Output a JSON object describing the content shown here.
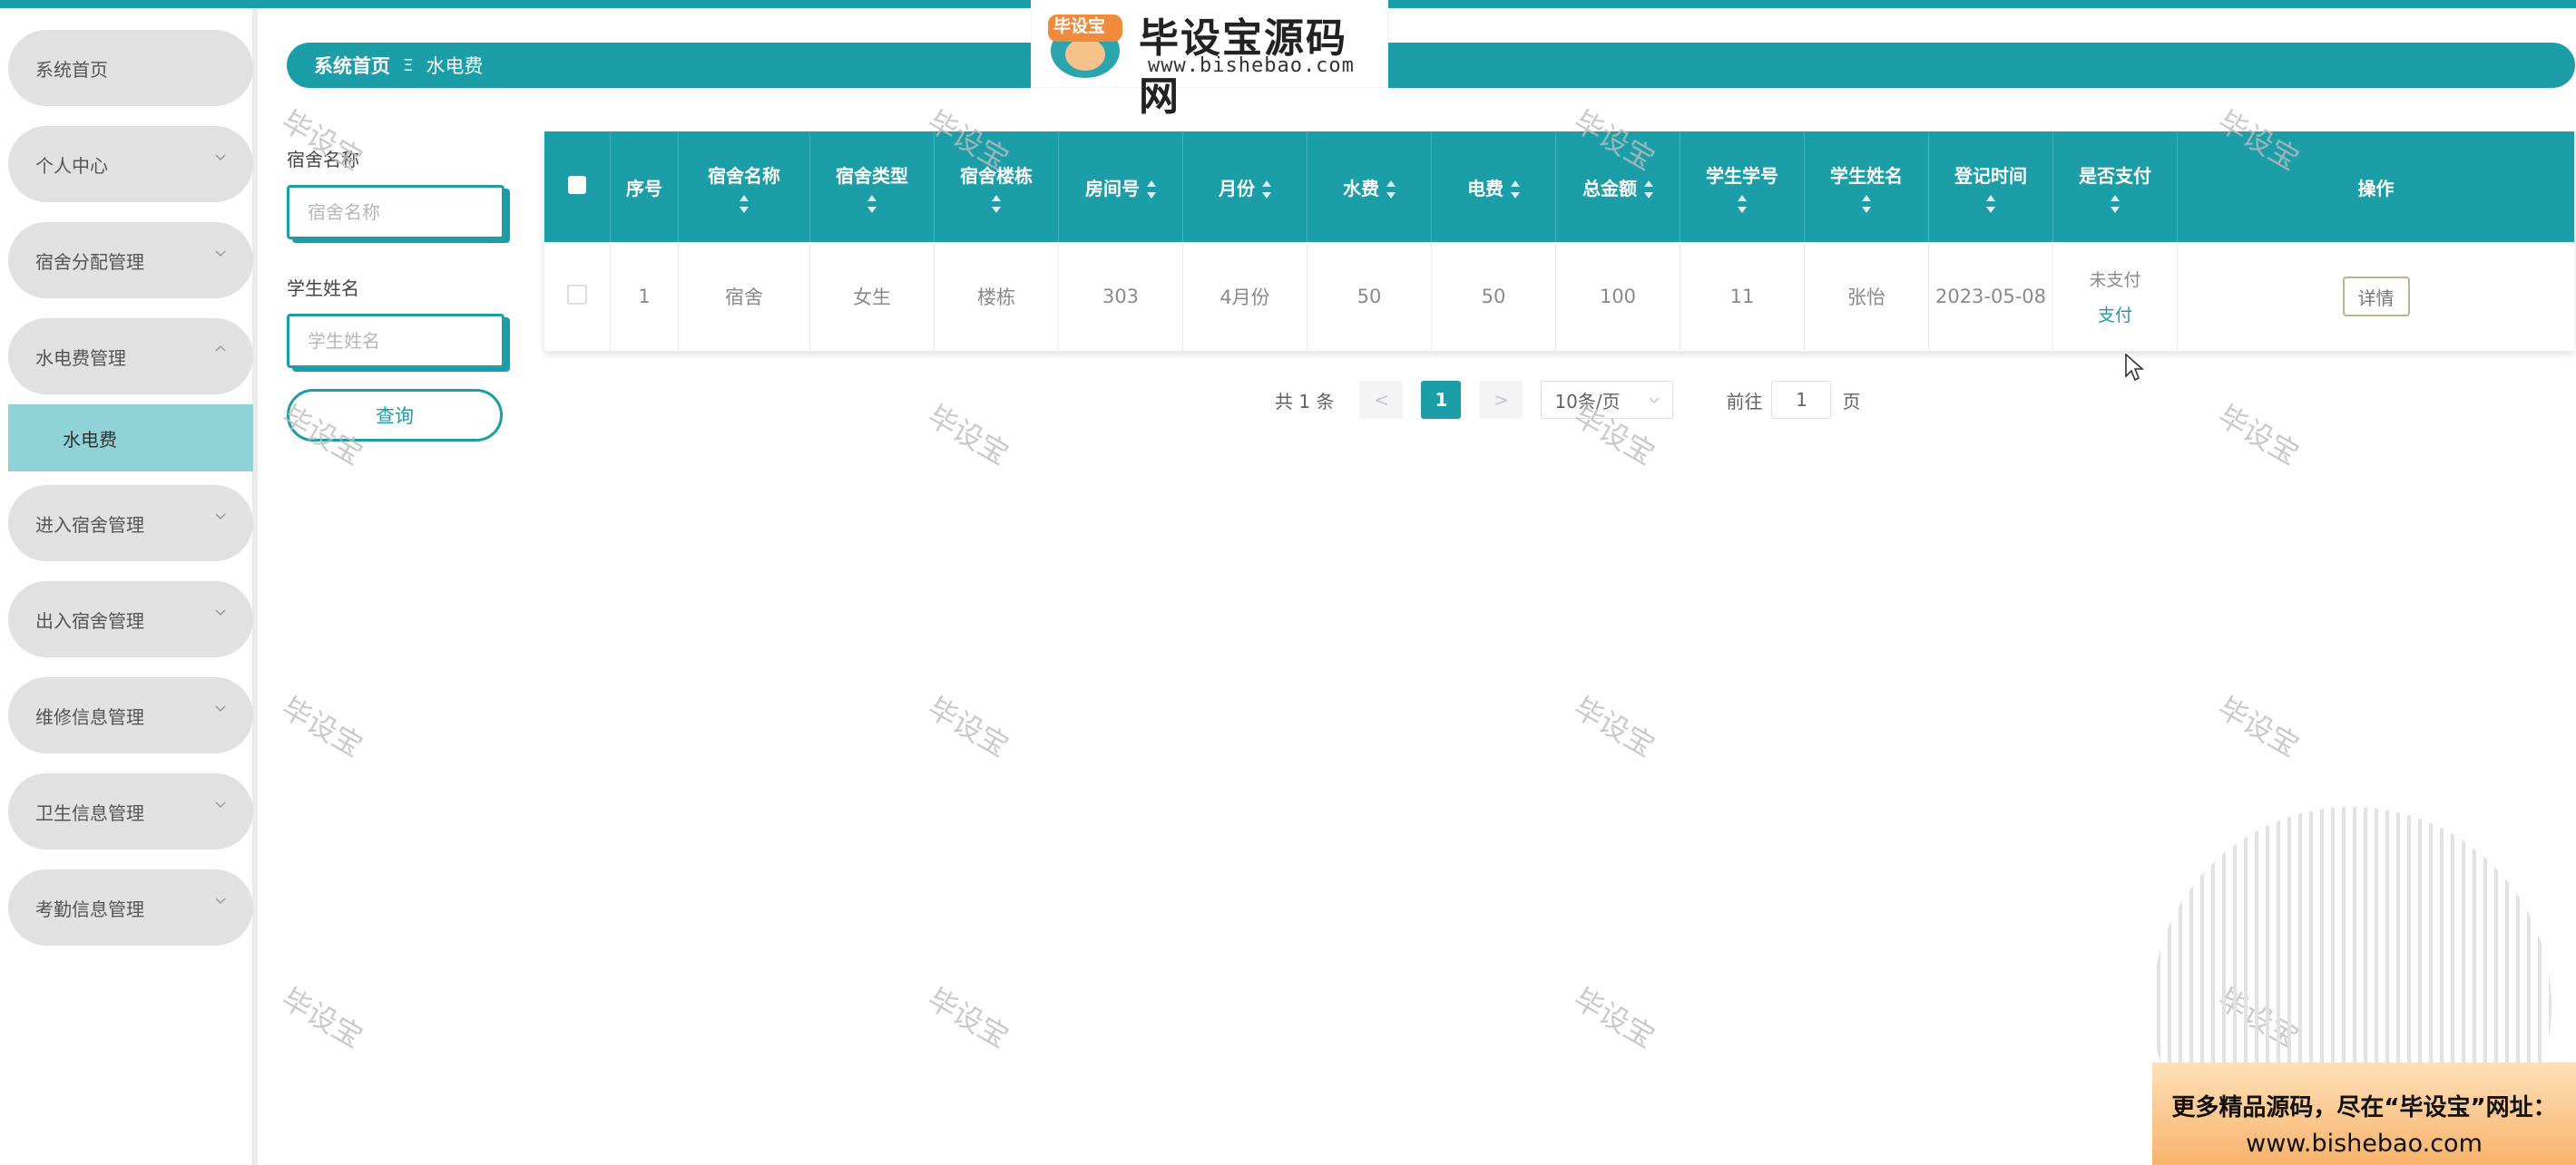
{
  "sidebar": {
    "items": [
      {
        "label": "系统首页"
      },
      {
        "label": "个人中心"
      },
      {
        "label": "宿舍分配管理"
      },
      {
        "label": "水电费管理"
      },
      {
        "label": "进入宿舍管理"
      },
      {
        "label": "出入宿舍管理"
      },
      {
        "label": "维修信息管理"
      },
      {
        "label": "卫生信息管理"
      },
      {
        "label": "考勤信息管理"
      }
    ],
    "active_sub": "水电费"
  },
  "breadcrumb": {
    "home": "系统首页",
    "separator": "Ξ",
    "current": "水电费"
  },
  "logo": {
    "badge": "毕设宝",
    "title": "毕设宝源码网",
    "url": "www.bishebao.com"
  },
  "search": {
    "dorm_name_label": "宿舍名称",
    "dorm_name_placeholder": "宿舍名称",
    "student_name_label": "学生姓名",
    "student_name_placeholder": "学生姓名",
    "query_button": "查询"
  },
  "table": {
    "headers": {
      "index": "序号",
      "dorm_name": "宿舍名称",
      "dorm_type": "宿舍类型",
      "building": "宿舍楼栋",
      "room": "房间号",
      "month": "月份",
      "water": "水费",
      "electric": "电费",
      "total": "总金额",
      "student_id": "学生学号",
      "student_name": "学生姓名",
      "reg_time": "登记时间",
      "paid": "是否支付",
      "actions": "操作"
    },
    "rows": [
      {
        "index": "1",
        "dorm_name": "宿舍",
        "dorm_type": "女生",
        "building": "楼栋",
        "room": "303",
        "month": "4月份",
        "water": "50",
        "electric": "50",
        "total": "100",
        "student_id": "11",
        "student_name": "张怡",
        "reg_time": "2023-05-08",
        "paid": "未支付",
        "pay_link": "支付",
        "detail": "详情"
      }
    ]
  },
  "pagination": {
    "total": "共 1 条",
    "prev": "<",
    "current": "1",
    "next": ">",
    "page_size": "10条/页",
    "goto_label": "前往",
    "goto_value": "1",
    "page_unit": "页"
  },
  "watermark": "毕设宝",
  "promo": {
    "line1": "更多精品源码，尽在“毕设宝”网址：",
    "line2": "www.bishebao.com"
  },
  "colors": {
    "accent": "#1b9ea7",
    "active_sub": "#8fd2d8",
    "menu_bg": "#e1e1e1"
  }
}
